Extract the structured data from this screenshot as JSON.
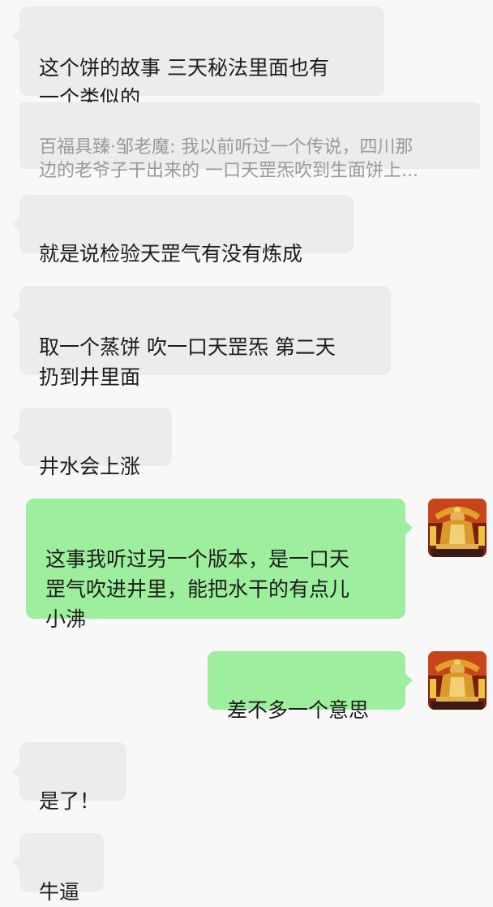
{
  "messages": [
    {
      "id": "m1",
      "side": "left",
      "text": "这个饼的故事 三天秘法里面也有\n一个类似的"
    },
    {
      "id": "m2",
      "kind": "quote",
      "sender": "百福具臻·邹老魔",
      "text": "我以前听过一个传说，四川那\n边的老爷子干出来的 一口天罡炁吹到生面饼上..."
    },
    {
      "id": "m3",
      "side": "left",
      "text": "就是说检验天罡气有没有炼成"
    },
    {
      "id": "m4",
      "side": "left",
      "text": "取一个蒸饼 吹一口天罡炁 第二天\n扔到井里面"
    },
    {
      "id": "m5",
      "side": "left",
      "text": "井水会上涨"
    },
    {
      "id": "m6",
      "side": "right",
      "text": "这事我听过另一个版本，是一口天\n罡气吹进井里，能把水干的有点儿\n小沸"
    },
    {
      "id": "m7",
      "side": "right",
      "text": "差不多一个意思"
    },
    {
      "id": "m8",
      "side": "left",
      "text": "是了！"
    },
    {
      "id": "m9",
      "side": "left",
      "text": "牛逼"
    }
  ],
  "quote_separator": ": ",
  "colors": {
    "background": "#f8f8f8",
    "incoming_bubble": "#ececee",
    "outgoing_bubble": "#9def9d",
    "quote_text": "#9a9a9a",
    "message_text": "#1c1c1c"
  },
  "avatar_icon": "golden-deity-statue-avatar"
}
